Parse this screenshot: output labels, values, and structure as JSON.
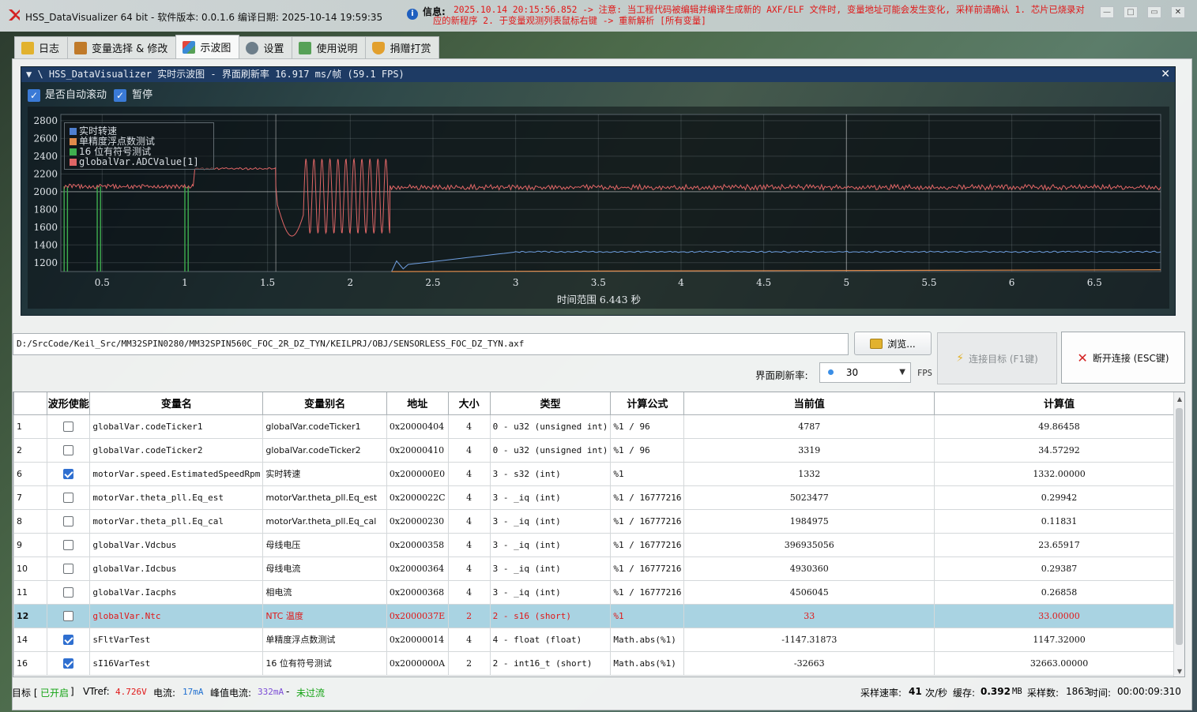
{
  "window": {
    "title": "HSS_DataVisualizer 64 bit - 软件版本: 0.0.1.6 编译日期: 2025-10-14 19:59:35",
    "info_label": "信息:",
    "info_text": "2025.10.14 20:15:56.852 -> 注意: 当工程代码被编辑并编译生成新的 AXF/ELF 文件时, 变量地址可能会发生变化, 采样前请确认 1. 芯片已烧录对应的新程序 2. 于变量观测列表鼠标右键 -> 重新解析 [所有变量]"
  },
  "tabs": [
    {
      "label": "日志",
      "icon": "log-icon",
      "color": "#e2b22e"
    },
    {
      "label": "变量选择 & 修改",
      "icon": "variable-icon",
      "color": "#c07a2a"
    },
    {
      "label": "示波图",
      "icon": "chart-icon",
      "color": "#3b8bd6"
    },
    {
      "label": "设置",
      "icon": "gear-icon",
      "color": "#6d7e8a"
    },
    {
      "label": "使用说明",
      "icon": "manual-icon",
      "color": "#57a157"
    },
    {
      "label": "捐赠打赏",
      "icon": "donate-icon",
      "color": "#e2a02e"
    }
  ],
  "active_tab": "示波图",
  "scope": {
    "header": "▼ \\ HSS_DataVisualizer 实时示波图 - 界面刷新率 16.917 ms/帧 (59.1 FPS)",
    "auto_scroll_label": "是否自动滚动",
    "pause_label": "暂停",
    "x_title": "时间范围 6.443 秒"
  },
  "chart_data": {
    "type": "line",
    "xlim": [
      0.25,
      6.9
    ],
    "ylim": [
      1100,
      2870
    ],
    "x_ticks": [
      "0.5",
      "1",
      "1.5",
      "2",
      "2.5",
      "3",
      "3.5",
      "4",
      "4.5",
      "5",
      "5.5",
      "6",
      "6.5"
    ],
    "x_tick_values": [
      0.5,
      1,
      1.5,
      2,
      2.5,
      3,
      3.5,
      4,
      4.5,
      5,
      5.5,
      6,
      6.5
    ],
    "y_ticks": [
      "1200",
      "1400",
      "1600",
      "1800",
      "2000",
      "2200",
      "2400",
      "2600",
      "2800"
    ],
    "y_tick_values": [
      1200,
      1400,
      1600,
      1800,
      2000,
      2200,
      2400,
      2600,
      2800
    ],
    "grid": true,
    "legend_position": "top-left",
    "xlabel": "时间范围 6.443 秒",
    "series": [
      {
        "name": "实时转速",
        "color": "#4f7fd0"
      },
      {
        "name": "单精度浮点数测试",
        "color": "#e08a4a"
      },
      {
        "name": "16 位有符号测试",
        "color": "#3fae4f"
      },
      {
        "name": "globalVar.ADCValue[1]",
        "color": "#e06666"
      }
    ],
    "red_series_points": [
      [
        0.25,
        2060
      ],
      [
        1.05,
        2060
      ],
      [
        1.06,
        2260
      ],
      [
        1.55,
        2260
      ],
      [
        1.57,
        2060
      ],
      [
        1.6,
        1800
      ],
      [
        1.65,
        1500
      ],
      [
        1.72,
        2400
      ],
      [
        1.8,
        1550
      ],
      [
        2.25,
        2050
      ],
      [
        6.9,
        2050
      ]
    ],
    "blue_series_points": [
      [
        2.25,
        1100
      ],
      [
        2.3,
        1200
      ],
      [
        2.35,
        1130
      ],
      [
        2.6,
        1290
      ],
      [
        3.0,
        1320
      ],
      [
        6.9,
        1320
      ]
    ],
    "orange_series_points": [
      [
        2.25,
        1100
      ],
      [
        6.9,
        1120
      ]
    ],
    "green_series_points": [
      [
        0.3,
        2150
      ],
      [
        0.35,
        1100
      ],
      [
        0.9,
        2150
      ],
      [
        0.95,
        1100
      ]
    ]
  },
  "file": {
    "path": "D:/SrcCode/Keil_Src/MM32SPIN0280/MM32SPIN560C_FOC_2R_DZ_TYN/KEILPRJ/OBJ/SENSORLESS_FOC_DZ_TYN.axf",
    "browse_label": "浏览..."
  },
  "controls": {
    "connect_label": "连接目标 (F1键)",
    "disconnect_label": "断开连接 (ESC键)",
    "refresh_label": "界面刷新率:",
    "refresh_value": "30",
    "fps_unit": "FPS"
  },
  "table": {
    "headers": [
      "",
      "波形使能",
      "变量名",
      "变量别名",
      "地址",
      "大小",
      "类型",
      "计算公式",
      "当前值",
      "计算值"
    ],
    "rows": [
      {
        "idx": "1",
        "on": false,
        "name": "globalVar.codeTicker1",
        "alias": "globalVar.codeTicker1",
        "addr": "0x20000404",
        "size": "4",
        "type": "0 - u32 (unsigned int)",
        "formula": "%1 / 96",
        "current": "4787",
        "calc": "49.86458"
      },
      {
        "idx": "2",
        "on": false,
        "name": "globalVar.codeTicker2",
        "alias": "globalVar.codeTicker2",
        "addr": "0x20000410",
        "size": "4",
        "type": "0 - u32 (unsigned int)",
        "formula": "%1 / 96",
        "current": "3319",
        "calc": "34.57292"
      },
      {
        "idx": "6",
        "on": true,
        "name": "motorVar.speed.EstimatedSpeedRpm",
        "alias": "实时转速",
        "addr": "0x200000E0",
        "size": "4",
        "type": "3 - s32 (int)",
        "formula": "%1",
        "current": "1332",
        "calc": "1332.00000"
      },
      {
        "idx": "7",
        "on": false,
        "name": "motorVar.theta_pll.Eq_est",
        "alias": "motorVar.theta_pll.Eq_est",
        "addr": "0x2000022C",
        "size": "4",
        "type": "3 - _iq (int)",
        "formula": "%1 / 16777216",
        "current": "5023477",
        "calc": "0.29942"
      },
      {
        "idx": "8",
        "on": false,
        "name": "motorVar.theta_pll.Eq_cal",
        "alias": "motorVar.theta_pll.Eq_cal",
        "addr": "0x20000230",
        "size": "4",
        "type": "3 - _iq (int)",
        "formula": "%1 / 16777216",
        "current": "1984975",
        "calc": "0.11831"
      },
      {
        "idx": "9",
        "on": false,
        "name": "globalVar.Vdcbus",
        "alias": "母线电压",
        "addr": "0x20000358",
        "size": "4",
        "type": "3 - _iq (int)",
        "formula": "%1 / 16777216",
        "current": "396935056",
        "calc": "23.65917"
      },
      {
        "idx": "10",
        "on": false,
        "name": "globalVar.Idcbus",
        "alias": "母线电流",
        "addr": "0x20000364",
        "size": "4",
        "type": "3 - _iq (int)",
        "formula": "%1 / 16777216",
        "current": "4930360",
        "calc": "0.29387"
      },
      {
        "idx": "11",
        "on": false,
        "name": "globalVar.Iacphs",
        "alias": "相电流",
        "addr": "0x20000368",
        "size": "4",
        "type": "3 - _iq (int)",
        "formula": "%1 / 16777216",
        "current": "4506045",
        "calc": "0.26858"
      },
      {
        "idx": "12",
        "on": false,
        "selected": true,
        "name": "globalVar.Ntc",
        "alias": "NTC 温度",
        "addr": "0x2000037E",
        "size": "2",
        "type": "2 - s16 (short)",
        "formula": "%1",
        "current": "33",
        "calc": "33.00000"
      },
      {
        "idx": "14",
        "on": true,
        "name": "sFltVarTest",
        "alias": "单精度浮点数测试",
        "addr": "0x20000014",
        "size": "4",
        "type": "4 - float (float)",
        "formula": "Math.abs(%1)",
        "current": "-1147.31873",
        "calc": "1147.32000"
      },
      {
        "idx": "16",
        "on": true,
        "name": "sI16VarTest",
        "alias": "16 位有符号测试",
        "addr": "0x2000000A",
        "size": "2",
        "type": "2 - int16_t (short)",
        "formula": "Math.abs(%1)",
        "current": "-32663",
        "calc": "32663.00000"
      }
    ]
  },
  "status": {
    "target_label": "目标 [",
    "target_state": "已开启",
    "target_close": "]",
    "vtref_label": "VTref:",
    "vtref_value": "4.726V",
    "current_label": "电流:",
    "current_value": "17mA",
    "peak_label": "峰值电流:",
    "peak_value": "332mA",
    "dash": "-",
    "overcurrent": "未过流",
    "rate_label": "采样速率:",
    "rate_value": "41",
    "rate_unit": "次/秒",
    "buffer_label": "缓存:",
    "buffer_value": "0.392",
    "buffer_unit": "MB",
    "samples_label": "采样数:",
    "samples_value": "1863",
    "time_label": "时间:",
    "time_value": "00:00:09:310"
  }
}
